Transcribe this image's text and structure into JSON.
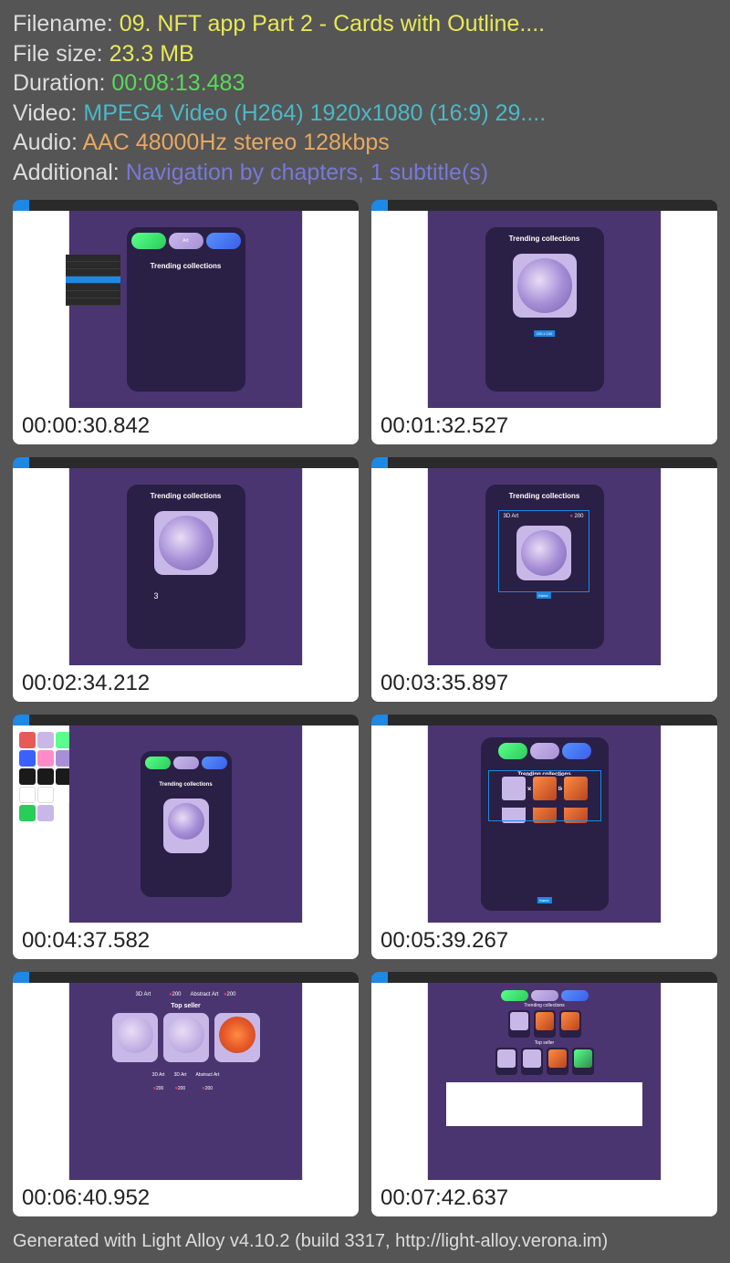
{
  "metadata": {
    "filename_label": "Filename: ",
    "filename_value": "09. NFT app Part 2 - Cards with Outline....",
    "filesize_label": "File size: ",
    "filesize_value": "23.3 MB",
    "duration_label": "Duration: ",
    "duration_value": "00:08:13.483",
    "video_label": "Video: ",
    "video_value": "MPEG4 Video (H264) 1920x1080 (16:9) 29....",
    "audio_label": "Audio: ",
    "audio_value": "AAC 48000Hz stereo 128kbps",
    "additional_label": "Additional: ",
    "additional_value": "Navigation by chapters, 1 subtitle(s)"
  },
  "thumbnails": [
    {
      "time": "00:00:30.842",
      "title": "Trending collections",
      "cat": "Art"
    },
    {
      "time": "00:01:32.527",
      "title": "Trending collections"
    },
    {
      "time": "00:02:34.212",
      "title": "Trending collections",
      "extra": "3"
    },
    {
      "time": "00:03:35.897",
      "title": "Trending collections",
      "label3d": "3D Art",
      "likes": "200"
    },
    {
      "time": "00:04:37.582",
      "title": "Trending collections"
    },
    {
      "time": "00:05:39.267",
      "title": "Trending collections",
      "label3d": "3D Art"
    },
    {
      "time": "00:06:40.952",
      "label3d": "3D Art",
      "likes": "200",
      "abstract": "Abstract Art",
      "section": "Top seller"
    },
    {
      "time": "00:07:42.637",
      "title": "Trending collections",
      "section": "Top seller"
    }
  ],
  "footer": "Generated with Light Alloy v4.10.2 (build 3317, http://light-alloy.verona.im)"
}
